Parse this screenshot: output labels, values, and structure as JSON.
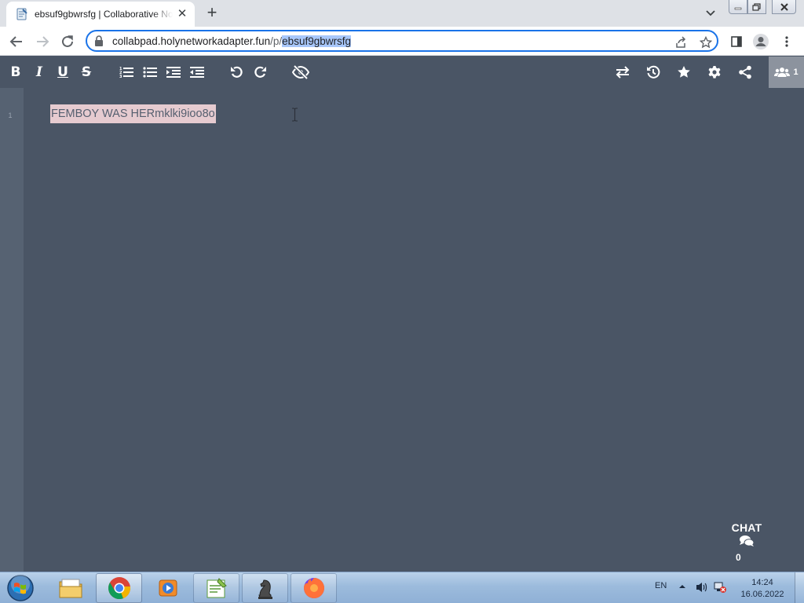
{
  "browser": {
    "tab_title": "ebsuf9gbwrsfg | Collaborative Notes",
    "url_host": "collabpad.holynetworkadapter.fun",
    "url_path_prefix": "/p/",
    "url_pad_id": "ebsuf9gbwrsfg"
  },
  "pad": {
    "toolbar_left": [
      "bold",
      "italic",
      "underline",
      "strikethrough",
      "ordered-list",
      "unordered-list",
      "indent",
      "outdent",
      "undo",
      "redo",
      "authorship-colors"
    ],
    "toolbar_right": [
      "import-export",
      "timeslider",
      "saved-revision",
      "settings",
      "share"
    ],
    "user_count": "1",
    "line_number": "1",
    "text": "FEMBOY WAS HERmklki9ioo8o"
  },
  "chat": {
    "label": "CHAT",
    "unread": "0"
  },
  "taskbar": {
    "language": "EN",
    "time": "14:24",
    "date": "16.06.2022",
    "apps": [
      "explorer",
      "chrome",
      "media-player",
      "notepad-plus",
      "chess",
      "firefox"
    ]
  },
  "colors": {
    "pad_bg": "#4a5565",
    "users_btn": "#8c939e",
    "author_highlight": "#e6cbd0",
    "omnibox_focus": "#1a73e8",
    "url_selection": "#a8c7fa"
  }
}
